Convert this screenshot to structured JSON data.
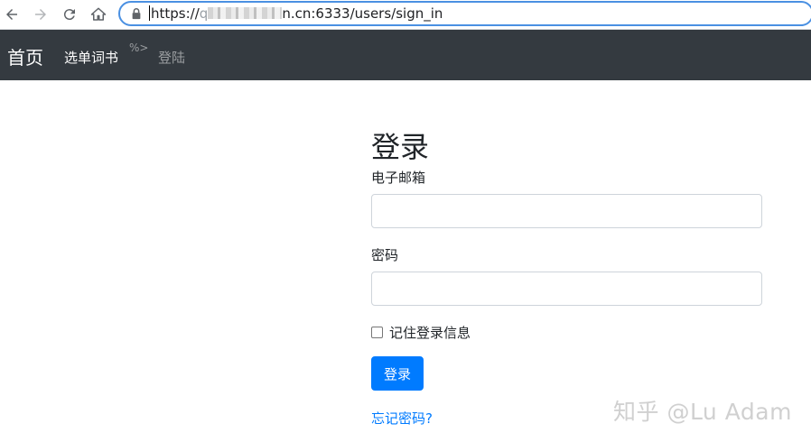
{
  "browser": {
    "url_prefix": "https://",
    "url_blur_lead": "q",
    "url_tail": "n.cn:6333/users/sign_in",
    "icons": [
      "back-icon",
      "forward-icon",
      "reload-icon",
      "home-icon",
      "lock-icon"
    ]
  },
  "navbar": {
    "brand": "首页",
    "links": [
      {
        "label": "选单词书",
        "state": "active"
      },
      {
        "label": "登陆",
        "state": "muted"
      }
    ],
    "stray_text": "%>",
    "background": "#343a40"
  },
  "form": {
    "title": "登录",
    "email_label": "电子邮箱",
    "email_value": "",
    "password_label": "密码",
    "password_value": "",
    "remember_label": "记住登录信息",
    "remember_checked": false,
    "submit_label": "登录",
    "forgot_link": "忘记密码?",
    "accent": "#007bff"
  },
  "watermark": "知乎 @Lu Adam"
}
